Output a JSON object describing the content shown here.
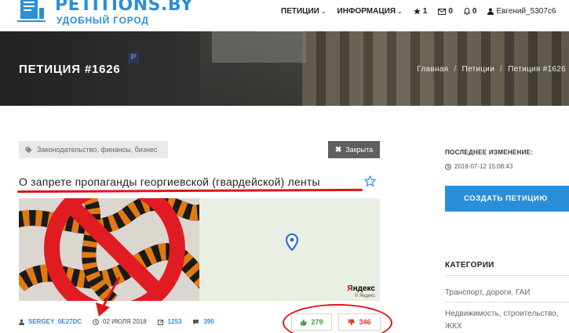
{
  "brand": {
    "name": "PETITIONS.BY",
    "tagline": "УДОБНЫЙ ГОРОД"
  },
  "nav": {
    "petitions": "ПЕТИЦИИ",
    "info": "ИНФОРМАЦИЯ",
    "favorites_count": "1",
    "messages_count": "0",
    "notifications_count": "0",
    "user": "Евгений_5307c6"
  },
  "hero": {
    "title": "ПЕТИЦИЯ #1626",
    "breadcrumbs": [
      "Главная",
      "Петиции",
      "Петиция #1626"
    ]
  },
  "petition": {
    "tags": "Законодательство, финансы, бизнес",
    "status": "Закрыта",
    "title": "О запрете пропаганды георгиевской (гвардейской) ленты",
    "author": "SERGEY_0E27DC",
    "date": "02 ИЮЛЯ 2018",
    "signatures": "1253",
    "comments": "390",
    "votes_up": "279",
    "votes_down": "346",
    "map_brand_a": "Я",
    "map_brand_b": "ндекс",
    "map_brand_sub": "© Яндекс"
  },
  "sidebar": {
    "last_change_label": "ПОСЛЕДНЕЕ ИЗМЕНЕНИЕ:",
    "last_change_value": "2018-07-12 15:08:43",
    "create_button": "СОЗДАТЬ ПЕТИЦИЮ",
    "categories_title": "КАТЕГОРИИ",
    "categories": [
      "Транспорт, дороги, ГАИ",
      "Недвижимость, строительство, ЖКХ"
    ]
  },
  "colors": {
    "accent": "#2a8fd8",
    "annotation_red": "#e1141c",
    "up": "#3a9a3a",
    "down": "#dd3333"
  }
}
